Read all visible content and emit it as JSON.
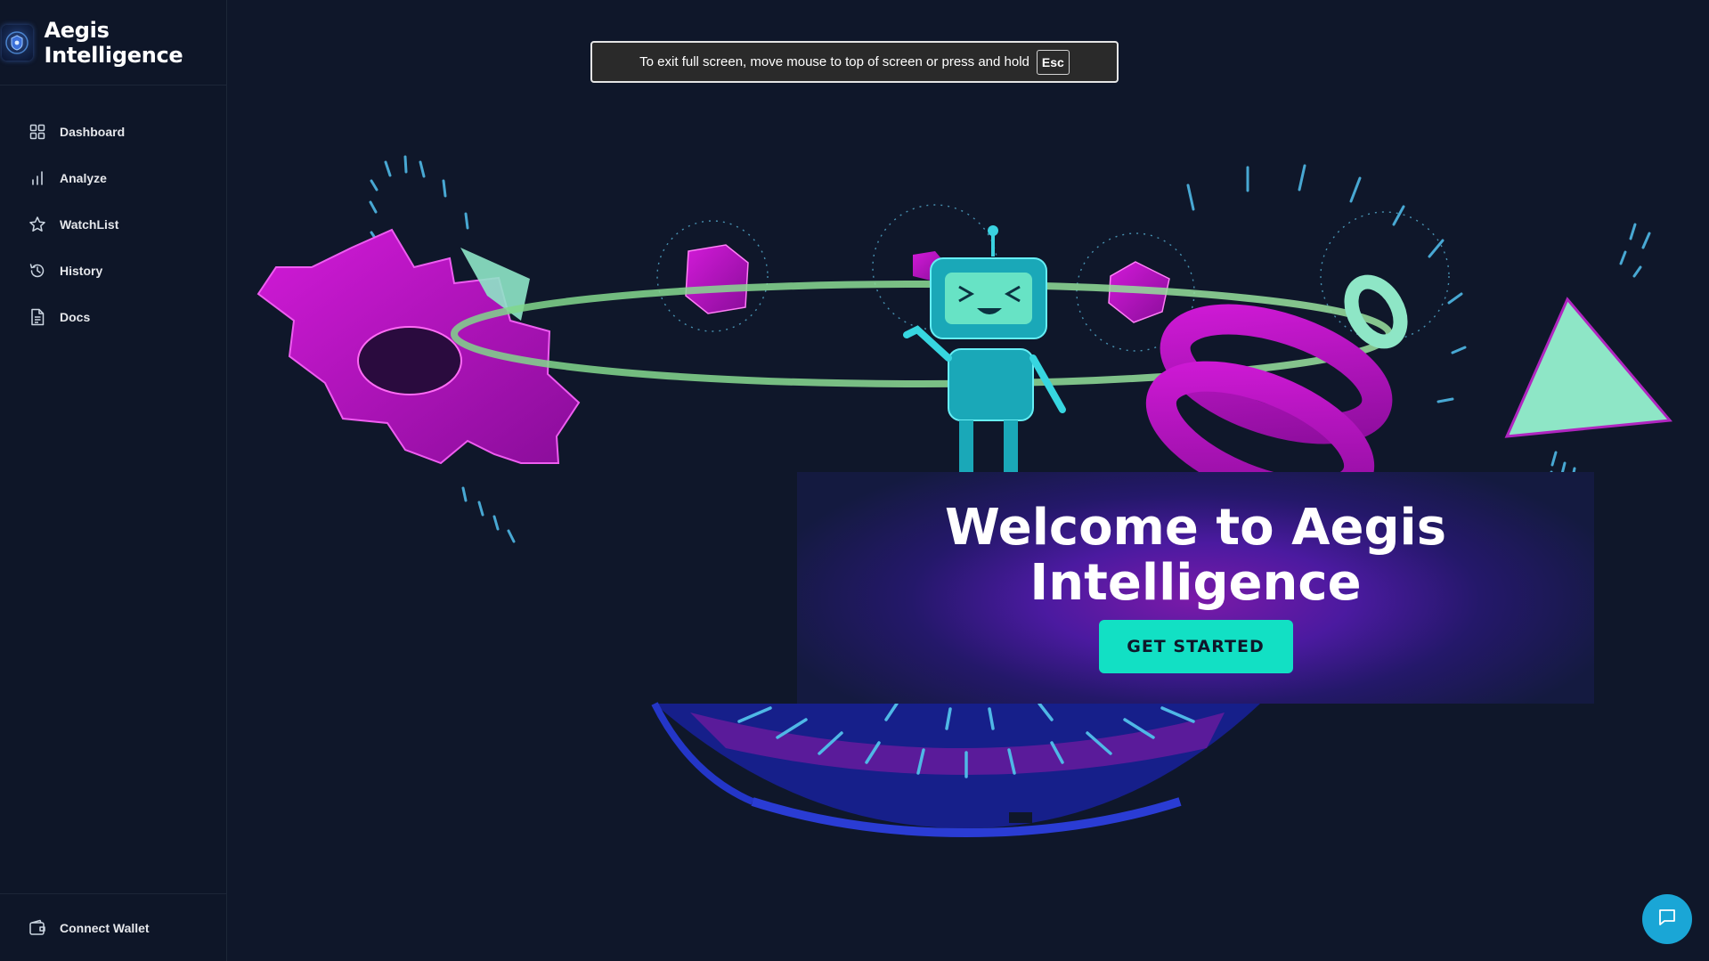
{
  "brand": {
    "title": "Aegis Intelligence"
  },
  "sidebar": {
    "items": [
      {
        "label": "Dashboard",
        "icon": "grid-icon"
      },
      {
        "label": "Analyze",
        "icon": "bar-chart-icon"
      },
      {
        "label": "WatchList",
        "icon": "star-icon"
      },
      {
        "label": "History",
        "icon": "history-icon"
      },
      {
        "label": "Docs",
        "icon": "document-icon"
      }
    ],
    "footer": {
      "label": "Connect Wallet",
      "icon": "wallet-icon"
    }
  },
  "fullscreen_notice": {
    "text": "To exit full screen, move mouse to top of screen or press and hold",
    "key": "Esc"
  },
  "hero": {
    "title": "Welcome to Aegis Intelligence",
    "cta_label": "GET STARTED"
  },
  "chat": {
    "icon": "chat-icon"
  },
  "colors": {
    "background": "#0f172a",
    "accent": "#12e0c4",
    "magenta": "#b014b8",
    "mint": "#8ee6c6"
  }
}
